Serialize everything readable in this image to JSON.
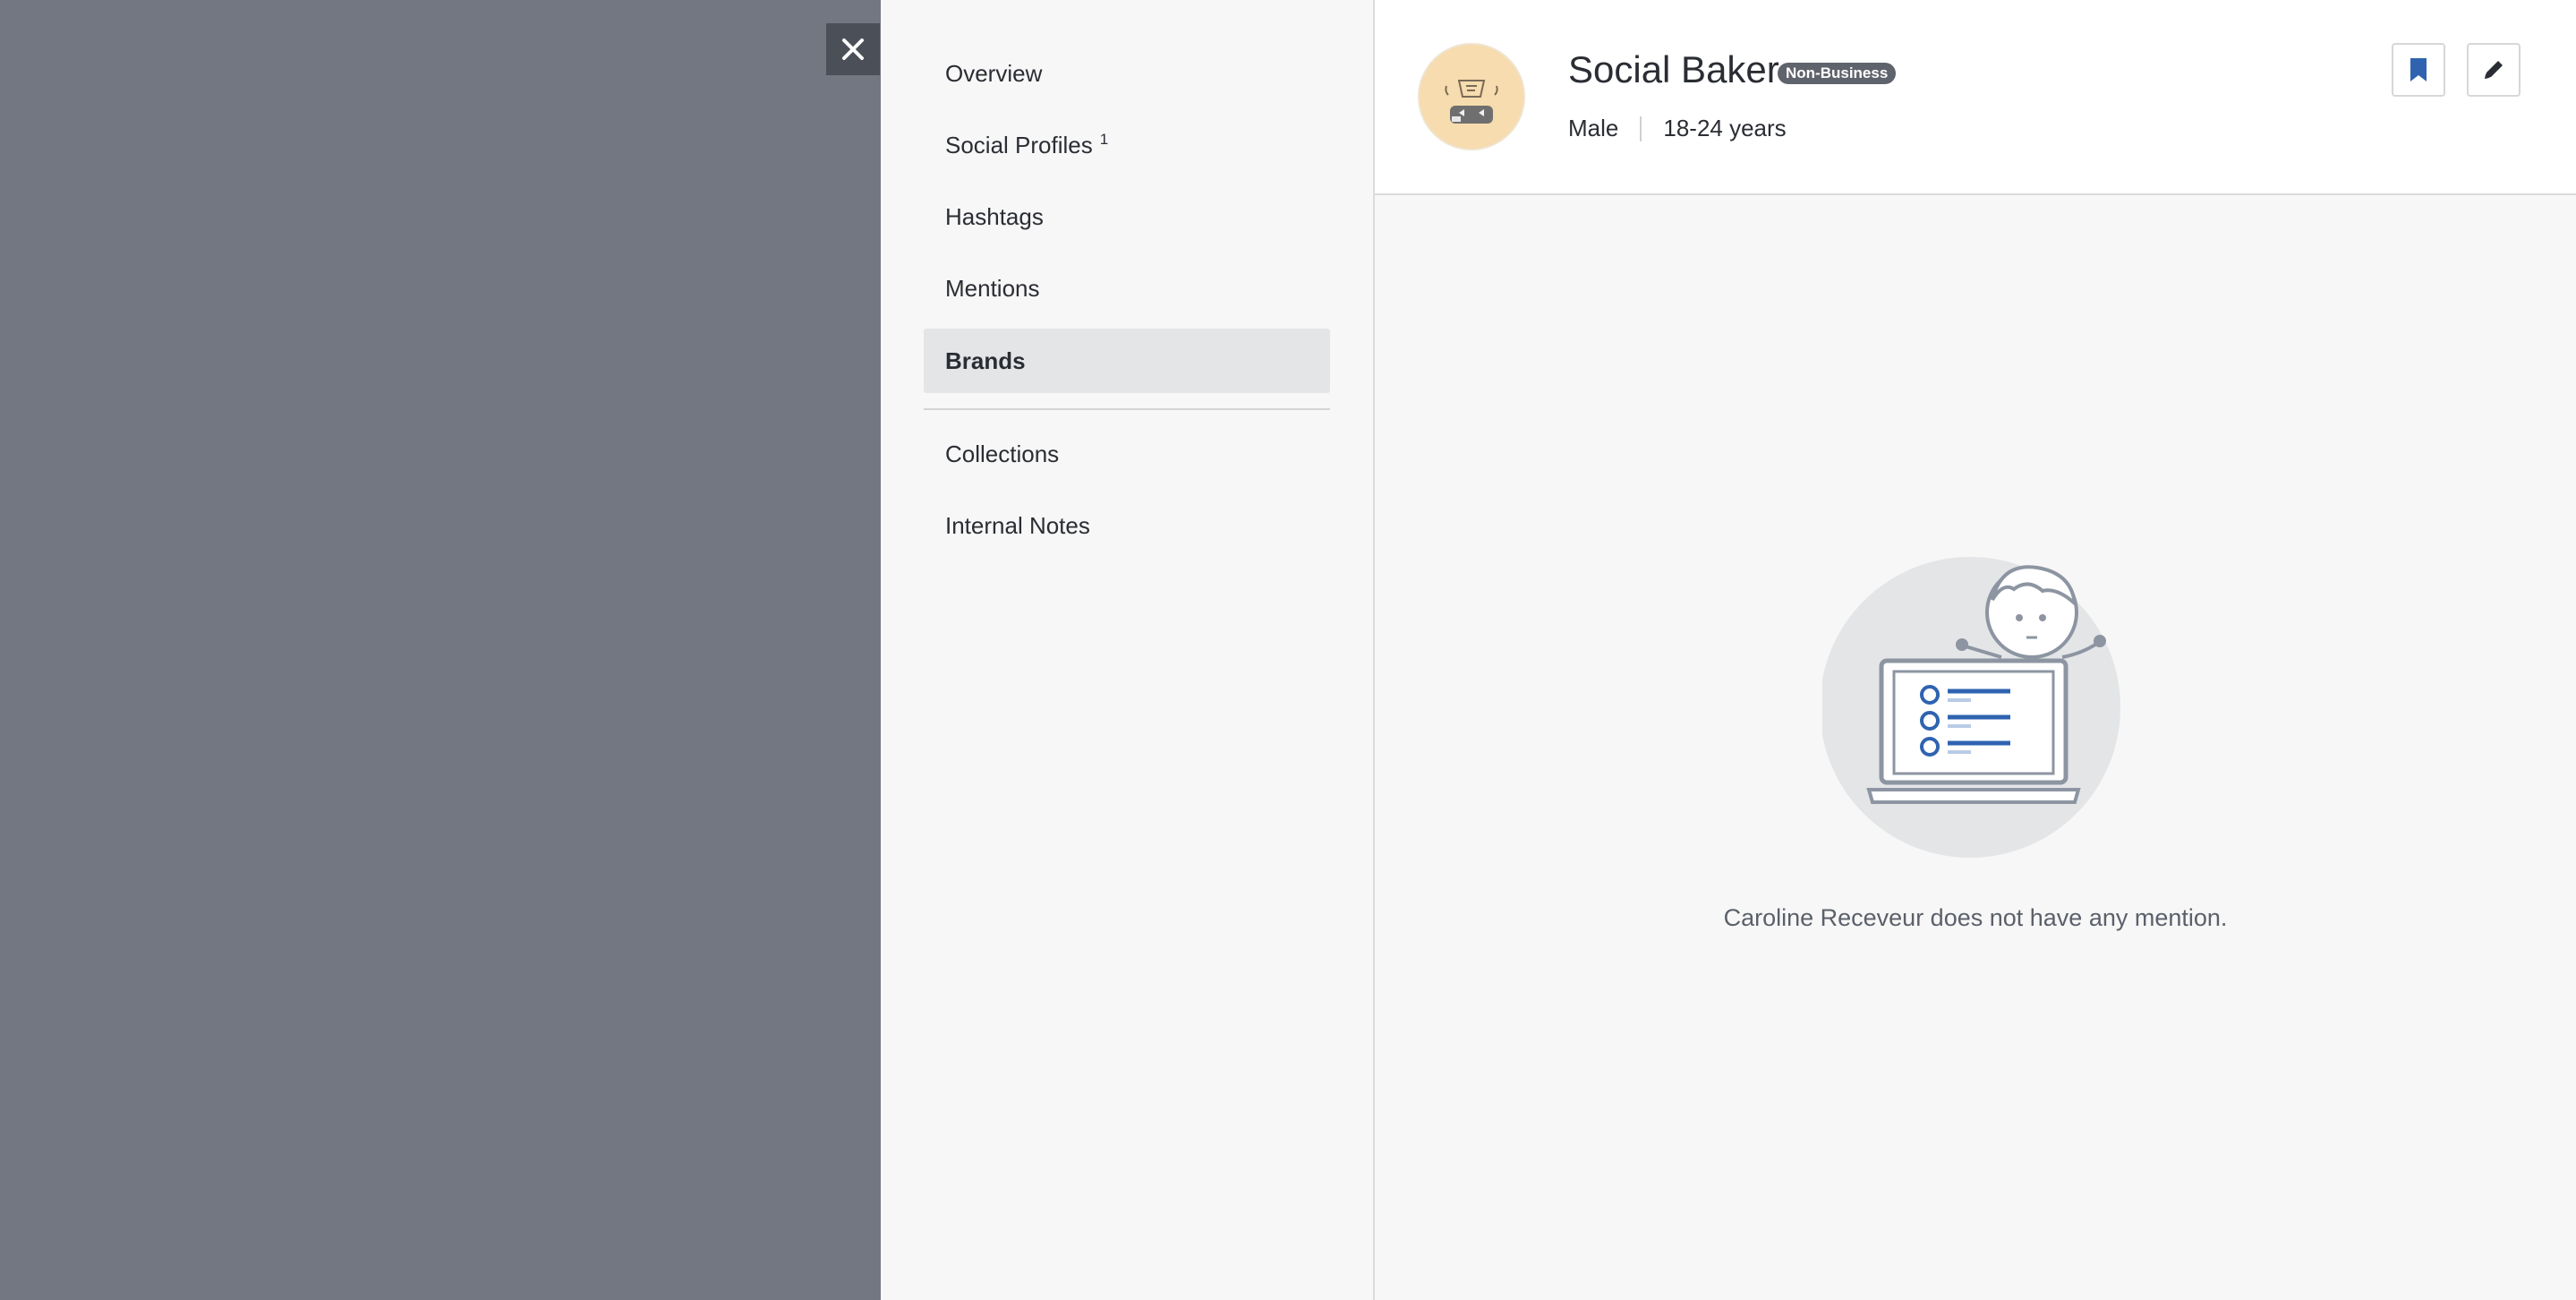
{
  "close": {
    "icon": "close-icon"
  },
  "nav": {
    "items": [
      {
        "label": "Overview",
        "sup": ""
      },
      {
        "label": "Social Profiles",
        "sup": "1"
      },
      {
        "label": "Hashtags",
        "sup": ""
      },
      {
        "label": "Mentions",
        "sup": ""
      },
      {
        "label": "Brands",
        "sup": "",
        "active": true
      },
      {
        "label": "Collections",
        "sup": ""
      },
      {
        "label": "Internal Notes",
        "sup": ""
      }
    ]
  },
  "profile": {
    "name": "Social Baker",
    "badge": "Non-Business",
    "gender": "Male",
    "age": "18-24 years"
  },
  "actions": {
    "bookmark_icon": "bookmark-icon",
    "edit_icon": "pencil-icon"
  },
  "empty_state": {
    "message": "Caroline Receveur does not have any mention."
  },
  "colors": {
    "accent": "#2f63b0",
    "overlay": "#737781"
  }
}
